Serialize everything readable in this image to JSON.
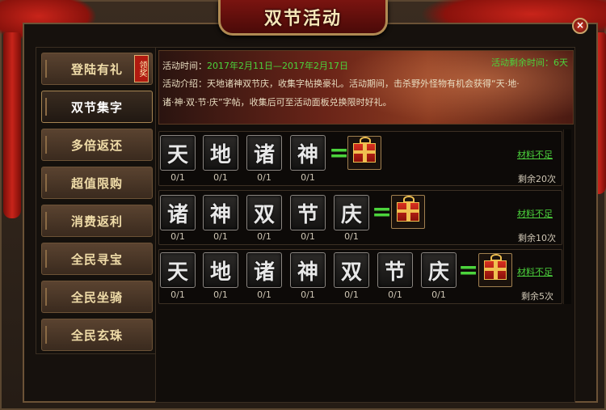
{
  "window": {
    "title": "双节活动",
    "close_glyph": "×"
  },
  "sidebar": {
    "items": [
      {
        "label": "登陆有礼",
        "badge": "领奖"
      },
      {
        "label": "双节集字"
      },
      {
        "label": "多倍返还"
      },
      {
        "label": "超值限购"
      },
      {
        "label": "消费返利"
      },
      {
        "label": "全民寻宝"
      },
      {
        "label": "全民坐骑"
      },
      {
        "label": "全民玄珠"
      }
    ]
  },
  "banner": {
    "time_label": "活动时间：",
    "time_value": "2017年2月11日—2017年2月17日",
    "remain_label": "活动剩余时间：",
    "remain_value": "6天",
    "intro_line1": "活动介绍：天地诸神双节庆，收集字帖换豪礼。活动期间，击杀野外怪物有机会获得“天·地·",
    "intro_line2": "诸·神·双·节·庆”字帖，收集后可至活动面板兑换限时好礼。"
  },
  "rows": [
    {
      "chars": [
        "天",
        "地",
        "诸",
        "神"
      ],
      "counts": [
        "0/1",
        "0/1",
        "0/1",
        "0/1"
      ],
      "equals": "=",
      "status": "材料不足",
      "remain": "剩余20次"
    },
    {
      "chars": [
        "诸",
        "神",
        "双",
        "节",
        "庆"
      ],
      "counts": [
        "0/1",
        "0/1",
        "0/1",
        "0/1",
        "0/1"
      ],
      "equals": "=",
      "status": "材料不足",
      "remain": "剩余10次"
    },
    {
      "chars": [
        "天",
        "地",
        "诸",
        "神",
        "双",
        "节",
        "庆"
      ],
      "counts": [
        "0/1",
        "0/1",
        "0/1",
        "0/1",
        "0/1",
        "0/1",
        "0/1"
      ],
      "equals": "=",
      "status": "材料不足",
      "remain": "剩余5次"
    }
  ],
  "colors": {
    "accent_green": "#4cd43c",
    "ribbon_red": "#c8241a",
    "gold": "#b08a52"
  }
}
